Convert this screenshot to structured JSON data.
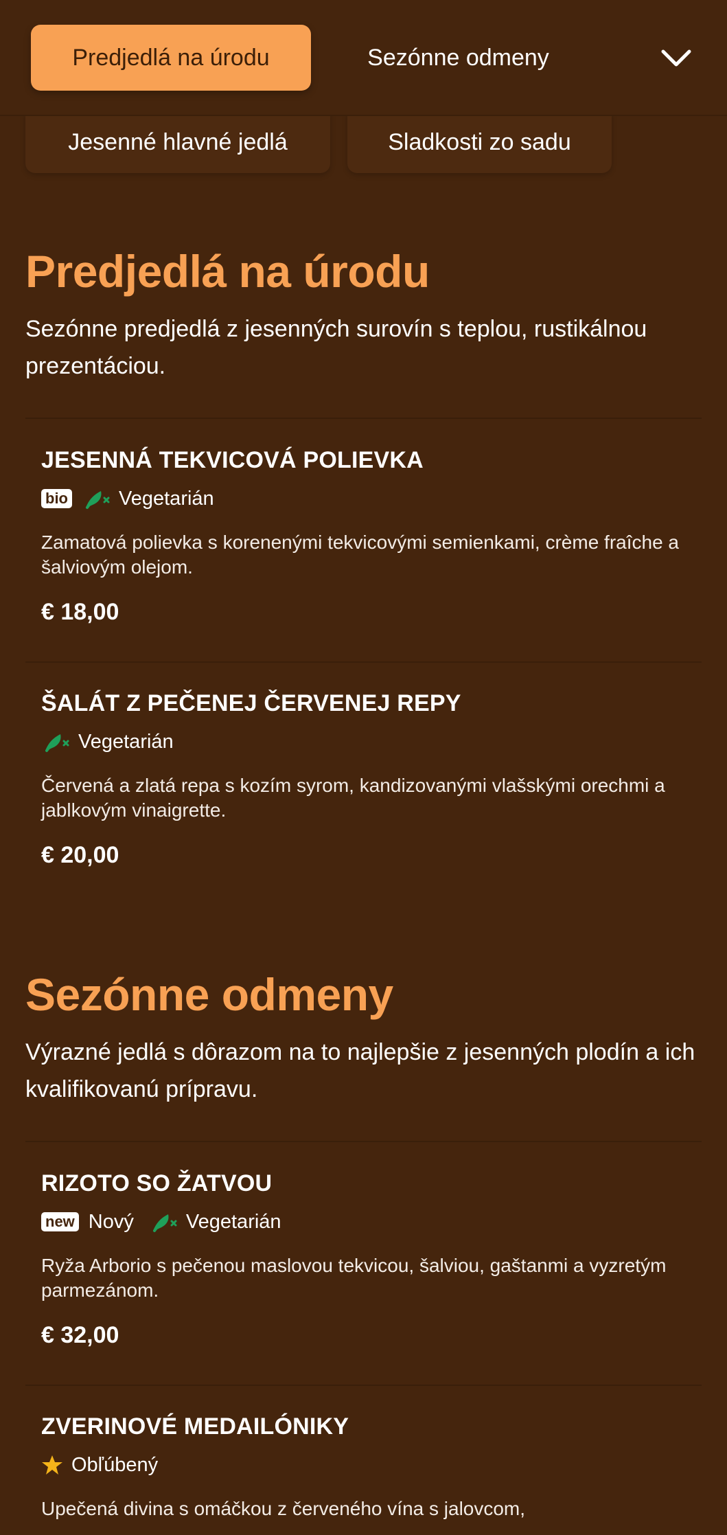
{
  "nav": {
    "tabs": [
      {
        "label": "Predjedlá na úrodu",
        "active": true
      },
      {
        "label": "Sezónne odmeny",
        "active": false
      }
    ],
    "secondary_tabs": [
      {
        "label": "Jesenné hlavné jedlá"
      },
      {
        "label": "Sladkosti zo sadu"
      }
    ],
    "expand_icon": "chevron-down-icon"
  },
  "colors": {
    "background": "#45250d",
    "accent": "#f8a154",
    "veg_icon": "#1fa05a",
    "star": "#f5b41a"
  },
  "sections": [
    {
      "title": "Predjedlá na úrodu",
      "description": "Sezónne predjedlá z jesenných surovín s teplou, rustikálnou prezentáciou.",
      "items": [
        {
          "name": "JESENNÁ TEKVICOVÁ POLIEVKA",
          "badge": "bio",
          "tag": "Vegetarián",
          "description": "Zamatová polievka s korenenými tekvicovými semienkami, crème fraîche a šalviovým olejom.",
          "price": "€ 18,00"
        },
        {
          "name": "ŠALÁT Z PEČENEJ ČERVENEJ REPY",
          "tag": "Vegetarián",
          "description": "Červená a zlatá repa s kozím syrom, kandizovanými vlašskými orechmi a jablkovým vinaigrette.",
          "price": "€ 20,00"
        }
      ]
    },
    {
      "title": "Sezónne odmeny",
      "description": "Výrazné jedlá s dôrazom na to najlepšie z jesenných plodín a ich kvalifikovanú prípravu.",
      "items": [
        {
          "name": "RIZOTO SO ŽATVOU",
          "badge": "new",
          "badge_label": "Nový",
          "tag": "Vegetarián",
          "description": "Ryža Arborio s pečenou maslovou tekvicou, šalviou, gaštanmi a vyzretým parmezánom.",
          "price": "€ 32,00"
        },
        {
          "name": "ZVERINOVÉ MEDAILÓNIKY",
          "tag": "Obľúbený",
          "description": "Upečená divina s omáčkou z červeného vína s jalovcom,"
        }
      ]
    }
  ]
}
